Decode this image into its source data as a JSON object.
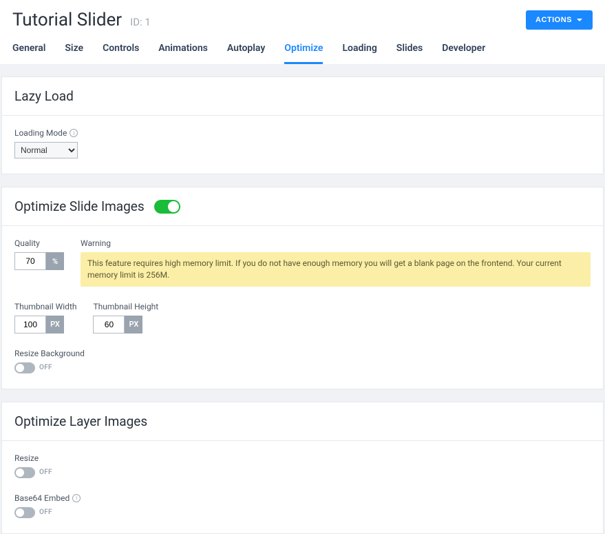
{
  "header": {
    "title": "Tutorial Slider",
    "id_label": "ID: 1",
    "actions_label": "ACTIONS"
  },
  "tabs": [
    {
      "label": "General",
      "active": false
    },
    {
      "label": "Size",
      "active": false
    },
    {
      "label": "Controls",
      "active": false
    },
    {
      "label": "Animations",
      "active": false
    },
    {
      "label": "Autoplay",
      "active": false
    },
    {
      "label": "Optimize",
      "active": true
    },
    {
      "label": "Loading",
      "active": false
    },
    {
      "label": "Slides",
      "active": false
    },
    {
      "label": "Developer",
      "active": false
    }
  ],
  "lazy_load": {
    "title": "Lazy Load",
    "mode_label": "Loading Mode",
    "mode_value": "Normal"
  },
  "optimize_slides": {
    "title": "Optimize Slide Images",
    "enabled": true,
    "quality_label": "Quality",
    "quality_value": "70",
    "quality_unit": "%",
    "warning_label": "Warning",
    "warning_text": "This feature requires high memory limit. If you do not have enough memory you will get a blank page on the frontend. Your current memory limit is 256M.",
    "thumb_w_label": "Thumbnail Width",
    "thumb_w_value": "100",
    "thumb_h_label": "Thumbnail Height",
    "thumb_h_value": "60",
    "px_unit": "PX",
    "resize_bg_label": "Resize Background",
    "resize_bg_state": "OFF"
  },
  "optimize_layers": {
    "title": "Optimize Layer Images",
    "resize_label": "Resize",
    "resize_state": "OFF",
    "base64_label": "Base64 Embed",
    "base64_state": "OFF"
  }
}
